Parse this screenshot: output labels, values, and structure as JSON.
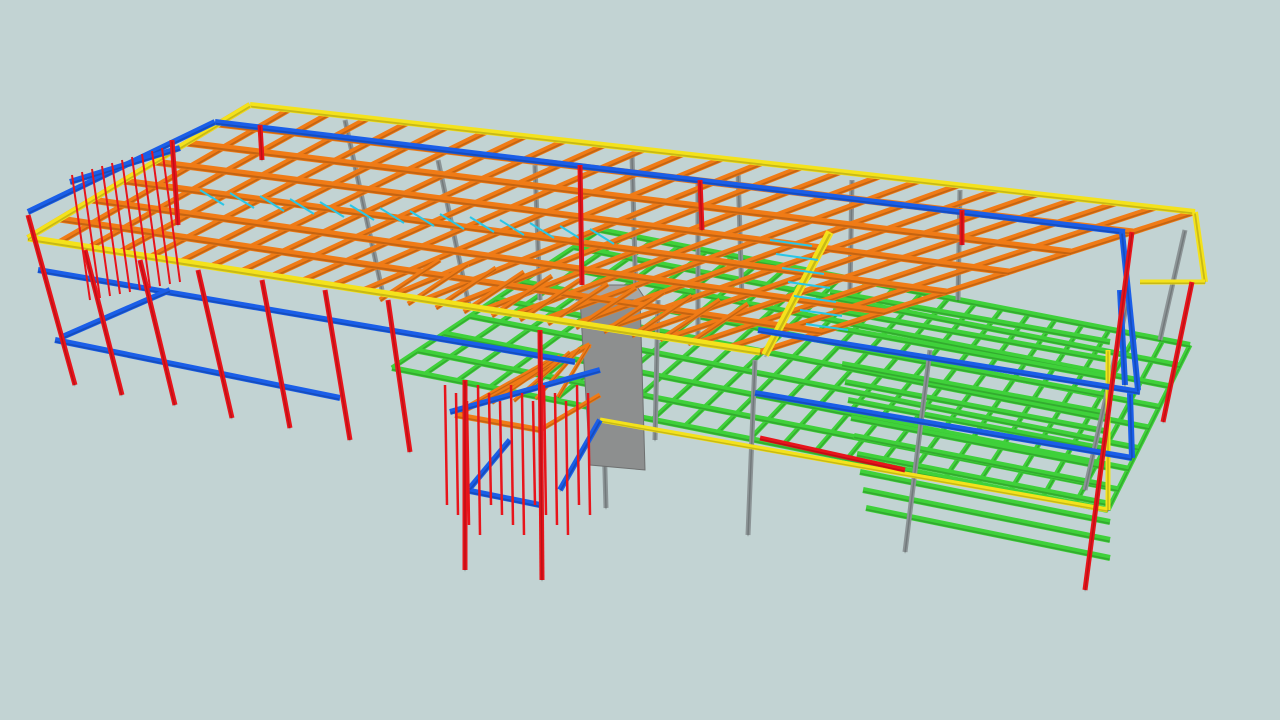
{
  "view": {
    "background_color": "#c2d3d3"
  },
  "model": {
    "member_colors": {
      "column": "#e8141b",
      "primary_beam": "#f07b16",
      "perimeter_beam": "#f4e21c",
      "secondary_beam": "#3fd13a",
      "bracing": "#1a5ee8",
      "grey_column": "#8c9496",
      "brace_light": "#29c6e6",
      "concrete_core": "#8d8f8f"
    },
    "icons": [
      "column-icon",
      "beam-icon",
      "bracing-icon",
      "stair-core-icon"
    ]
  }
}
